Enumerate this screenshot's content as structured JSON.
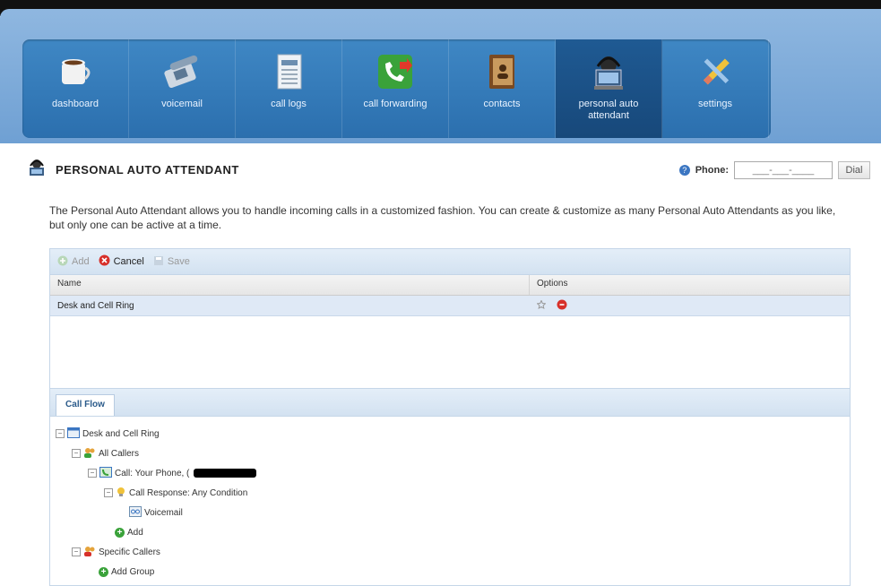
{
  "nav": {
    "items": [
      {
        "label": "dashboard",
        "icon": "coffee-mug-icon"
      },
      {
        "label": "voicemail",
        "icon": "telephone-icon"
      },
      {
        "label": "call logs",
        "icon": "document-log-icon"
      },
      {
        "label": "call forwarding",
        "icon": "phone-forward-icon"
      },
      {
        "label": "contacts",
        "icon": "address-book-icon"
      },
      {
        "label": "personal auto attendant",
        "icon": "operator-headset-icon"
      },
      {
        "label": "settings",
        "icon": "pencil-tools-icon"
      }
    ],
    "active_index": 5
  },
  "page": {
    "title": "PERSONAL AUTO ATTENDANT",
    "phone_label": "Phone:",
    "phone_placeholder": "___-___-____",
    "dial_label": "Dial",
    "description": "The Personal Auto Attendant allows you to handle incoming calls in a customized fashion. You can create & customize as many Personal Auto Attendants as you like, but only one can be active at a time."
  },
  "toolbar": {
    "add": "Add",
    "cancel": "Cancel",
    "save": "Save"
  },
  "table": {
    "columns": [
      "Name",
      "Options"
    ],
    "rows": [
      {
        "name": "Desk and Cell Ring"
      }
    ]
  },
  "callflow": {
    "tab_label": "Call Flow",
    "nodes": [
      {
        "label": "Desk and Cell Ring"
      },
      {
        "label": "All Callers"
      },
      {
        "label": "Call: Your Phone, ("
      },
      {
        "label": "Call Response: Any Condition"
      },
      {
        "label": "Voicemail"
      },
      {
        "label": "Add"
      },
      {
        "label": "Specific Callers"
      },
      {
        "label": "Add Group"
      }
    ]
  },
  "colors": {
    "nav_bg": "#2b6fae",
    "nav_active": "#17487a",
    "row_selected": "#dfe9f6"
  }
}
